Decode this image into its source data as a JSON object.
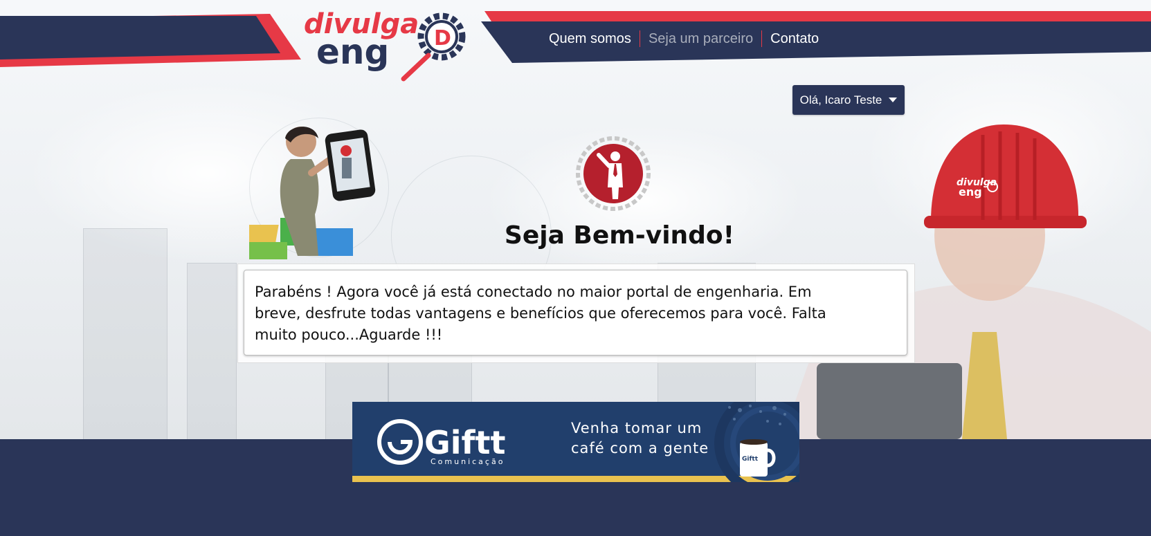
{
  "header": {
    "logo_text_top": "divulga",
    "logo_text_bottom": "eng",
    "logo_badge": "D",
    "nav": [
      {
        "label": "Quem somos"
      },
      {
        "label": "Seja um parceiro"
      },
      {
        "label": "Contato"
      }
    ]
  },
  "user_menu": {
    "label": "Olá, Icaro Teste"
  },
  "welcome": {
    "title": "Seja Bem-vindo!",
    "message": "Parabéns ! Agora você já está conectado no maior portal de engenharia. Em breve, desfrute todas vantagens e benefícios que oferecemos para você. Falta muito pouco...Aguarde !!!"
  },
  "banner": {
    "brand": "Giftt",
    "brand_sub": "Comunicação",
    "tagline_1": "Venha tomar um",
    "tagline_2": "café com a gente",
    "mug_text": "Giftt"
  },
  "helmet_logo": {
    "top": "divulga",
    "bottom": "eng"
  },
  "colors": {
    "navy": "#2a3558",
    "red": "#e63946",
    "banner_blue": "#213f6c",
    "banner_gold": "#e9c24f",
    "emblem_red": "#b5202d"
  },
  "icons": [
    "gear-icon",
    "magnifier-icon",
    "person-icon",
    "phone-icon",
    "caret-down-icon",
    "coffee-mug-icon"
  ]
}
